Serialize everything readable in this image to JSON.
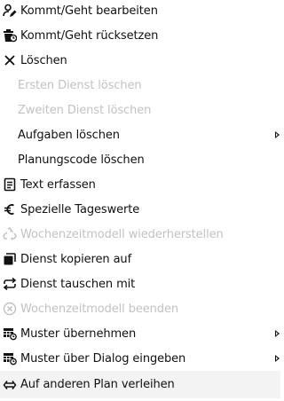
{
  "menu": {
    "items": [
      {
        "label": "Kommt/Geht bearbeiten",
        "icon": "user-edit-icon",
        "enabled": true
      },
      {
        "label": "Kommt/Geht rücksetzen",
        "icon": "trash-clock-icon",
        "enabled": true
      },
      {
        "label": "Löschen",
        "icon": "close-icon",
        "enabled": true
      },
      {
        "label": "Ersten Dienst löschen",
        "icon": "",
        "enabled": false
      },
      {
        "label": "Zweiten Dienst löschen",
        "icon": "",
        "enabled": false
      },
      {
        "label": "Aufgaben löschen",
        "icon": "",
        "enabled": true,
        "submenu": true
      },
      {
        "label": "Planungscode löschen",
        "icon": "",
        "enabled": true
      },
      {
        "label": "Text erfassen",
        "icon": "document-text-icon",
        "enabled": true
      },
      {
        "label": "Spezielle Tageswerte",
        "icon": "euro-icon",
        "enabled": true
      },
      {
        "label": "Wochenzeitmodell wiederherstellen",
        "icon": "recycle-icon",
        "enabled": false
      },
      {
        "label": "Dienst kopieren auf",
        "icon": "copy-icon",
        "enabled": true
      },
      {
        "label": "Dienst tauschen mit",
        "icon": "swap-icon",
        "enabled": true
      },
      {
        "label": "Wochenzeitmodell beenden",
        "icon": "circle-x-icon",
        "enabled": false
      },
      {
        "label": "Muster übernehmen",
        "icon": "pattern-grid-icon",
        "enabled": true,
        "submenu": true
      },
      {
        "label": "Muster über Dialog eingeben",
        "icon": "pattern-grid-icon",
        "enabled": true,
        "submenu": true
      },
      {
        "label": "Auf anderen Plan verleihen",
        "icon": "left-right-arrow-icon",
        "enabled": true
      }
    ]
  },
  "colors": {
    "text": "#111111",
    "disabled_text": "#c2c2c2",
    "hover_bg": "#f3f3f3"
  }
}
